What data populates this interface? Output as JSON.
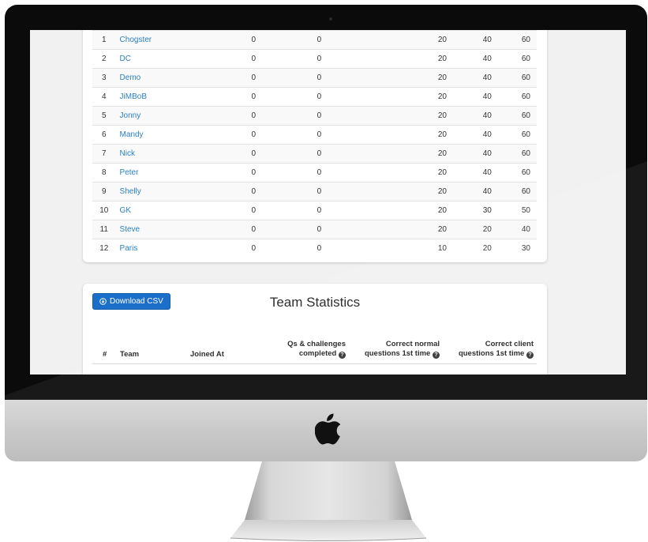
{
  "scores": {
    "rows": [
      {
        "rank": "1",
        "team": "Chogster",
        "c1": "0",
        "c2": "0",
        "c3": "20",
        "c4": "40",
        "c5": "60"
      },
      {
        "rank": "2",
        "team": "DC",
        "c1": "0",
        "c2": "0",
        "c3": "20",
        "c4": "40",
        "c5": "60"
      },
      {
        "rank": "3",
        "team": "Demo",
        "c1": "0",
        "c2": "0",
        "c3": "20",
        "c4": "40",
        "c5": "60"
      },
      {
        "rank": "4",
        "team": "JiMBoB",
        "c1": "0",
        "c2": "0",
        "c3": "20",
        "c4": "40",
        "c5": "60"
      },
      {
        "rank": "5",
        "team": "Jonny",
        "c1": "0",
        "c2": "0",
        "c3": "20",
        "c4": "40",
        "c5": "60"
      },
      {
        "rank": "6",
        "team": "Mandy",
        "c1": "0",
        "c2": "0",
        "c3": "20",
        "c4": "40",
        "c5": "60"
      },
      {
        "rank": "7",
        "team": "Nick",
        "c1": "0",
        "c2": "0",
        "c3": "20",
        "c4": "40",
        "c5": "60"
      },
      {
        "rank": "8",
        "team": "Peter",
        "c1": "0",
        "c2": "0",
        "c3": "20",
        "c4": "40",
        "c5": "60"
      },
      {
        "rank": "9",
        "team": "Shelly",
        "c1": "0",
        "c2": "0",
        "c3": "20",
        "c4": "40",
        "c5": "60"
      },
      {
        "rank": "10",
        "team": "GK",
        "c1": "0",
        "c2": "0",
        "c3": "20",
        "c4": "30",
        "c5": "50"
      },
      {
        "rank": "11",
        "team": "Steve",
        "c1": "0",
        "c2": "0",
        "c3": "20",
        "c4": "20",
        "c5": "40"
      },
      {
        "rank": "12",
        "team": "Paris",
        "c1": "0",
        "c2": "0",
        "c3": "10",
        "c4": "20",
        "c5": "30"
      }
    ]
  },
  "team_statistics": {
    "download_button": "Download CSV",
    "download_icon": "download-circle-icon",
    "title": "Team Statistics",
    "headers": {
      "rank": "#",
      "team": "Team",
      "joined_at": "Joined At",
      "qs_line1": "Qs & challenges",
      "qs_line2": "completed",
      "normal_line1": "Correct normal",
      "normal_line2": "questions 1st time",
      "client_line1": "Correct client",
      "client_line2": "questions 1st time",
      "help_icon": "question-circle-icon"
    }
  },
  "device": {
    "logo": "apple-logo-icon"
  },
  "colors": {
    "link": "#2a7fc4",
    "button": "#1b6fc9"
  }
}
